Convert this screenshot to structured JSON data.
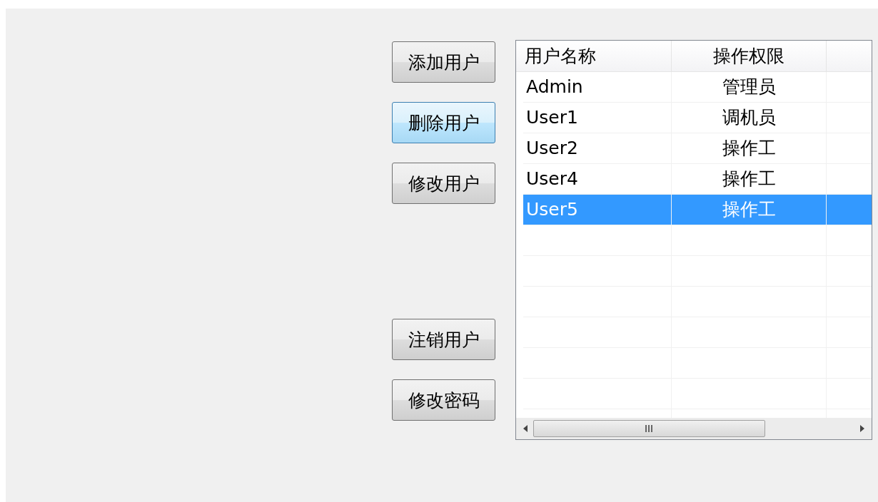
{
  "button_groups": [
    [
      {
        "label": "添加用户",
        "hovered": false
      },
      {
        "label": "删除用户",
        "hovered": true
      },
      {
        "label": "修改用户",
        "hovered": false
      }
    ],
    [
      {
        "label": "注销用户",
        "hovered": false
      },
      {
        "label": "修改密码",
        "hovered": false
      }
    ]
  ],
  "table": {
    "columns": [
      "用户名称",
      "操作权限"
    ],
    "rows": [
      {
        "name": "Admin",
        "role": "管理员",
        "selected": false
      },
      {
        "name": "User1",
        "role": "调机员",
        "selected": false
      },
      {
        "name": "User2",
        "role": "操作工",
        "selected": false
      },
      {
        "name": "User4",
        "role": "操作工",
        "selected": false
      },
      {
        "name": "User5",
        "role": "操作工",
        "selected": true
      }
    ]
  }
}
